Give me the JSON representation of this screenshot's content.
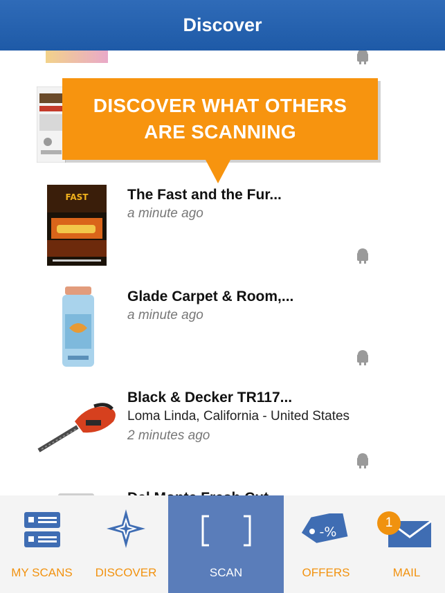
{
  "header": {
    "title": "Discover"
  },
  "callout": {
    "line1": "DISCOVER WHAT OTHERS",
    "line2": "ARE SCANNING"
  },
  "feed": {
    "items": [
      {
        "title": "The Fast and the Fur...",
        "location": "",
        "time": "a minute ago",
        "platform_icon": "android-icon"
      },
      {
        "title": "Glade Carpet & Room,...",
        "location": "",
        "time": "a minute ago",
        "platform_icon": "android-icon"
      },
      {
        "title": "Black & Decker TR117...",
        "location": "Loma Linda, California - United States",
        "time": "2 minutes ago",
        "platform_icon": "android-icon"
      },
      {
        "title": "Del Monte Fresh Cut...",
        "location": "",
        "time": "",
        "platform_icon": "android-icon"
      }
    ]
  },
  "tabs": [
    {
      "label": "MY SCANS",
      "icon": "list-icon"
    },
    {
      "label": "DISCOVER",
      "icon": "compass-icon"
    },
    {
      "label": "SCAN",
      "icon": "scan-brackets-icon",
      "selected": true
    },
    {
      "label": "OFFERS",
      "icon": "tag-percent-icon"
    },
    {
      "label": "MAIL",
      "icon": "envelope-icon",
      "badge": "1"
    }
  ],
  "colors": {
    "nav": "#2363ae",
    "accent": "#f7940f",
    "scan_tab": "#5a7dba"
  }
}
